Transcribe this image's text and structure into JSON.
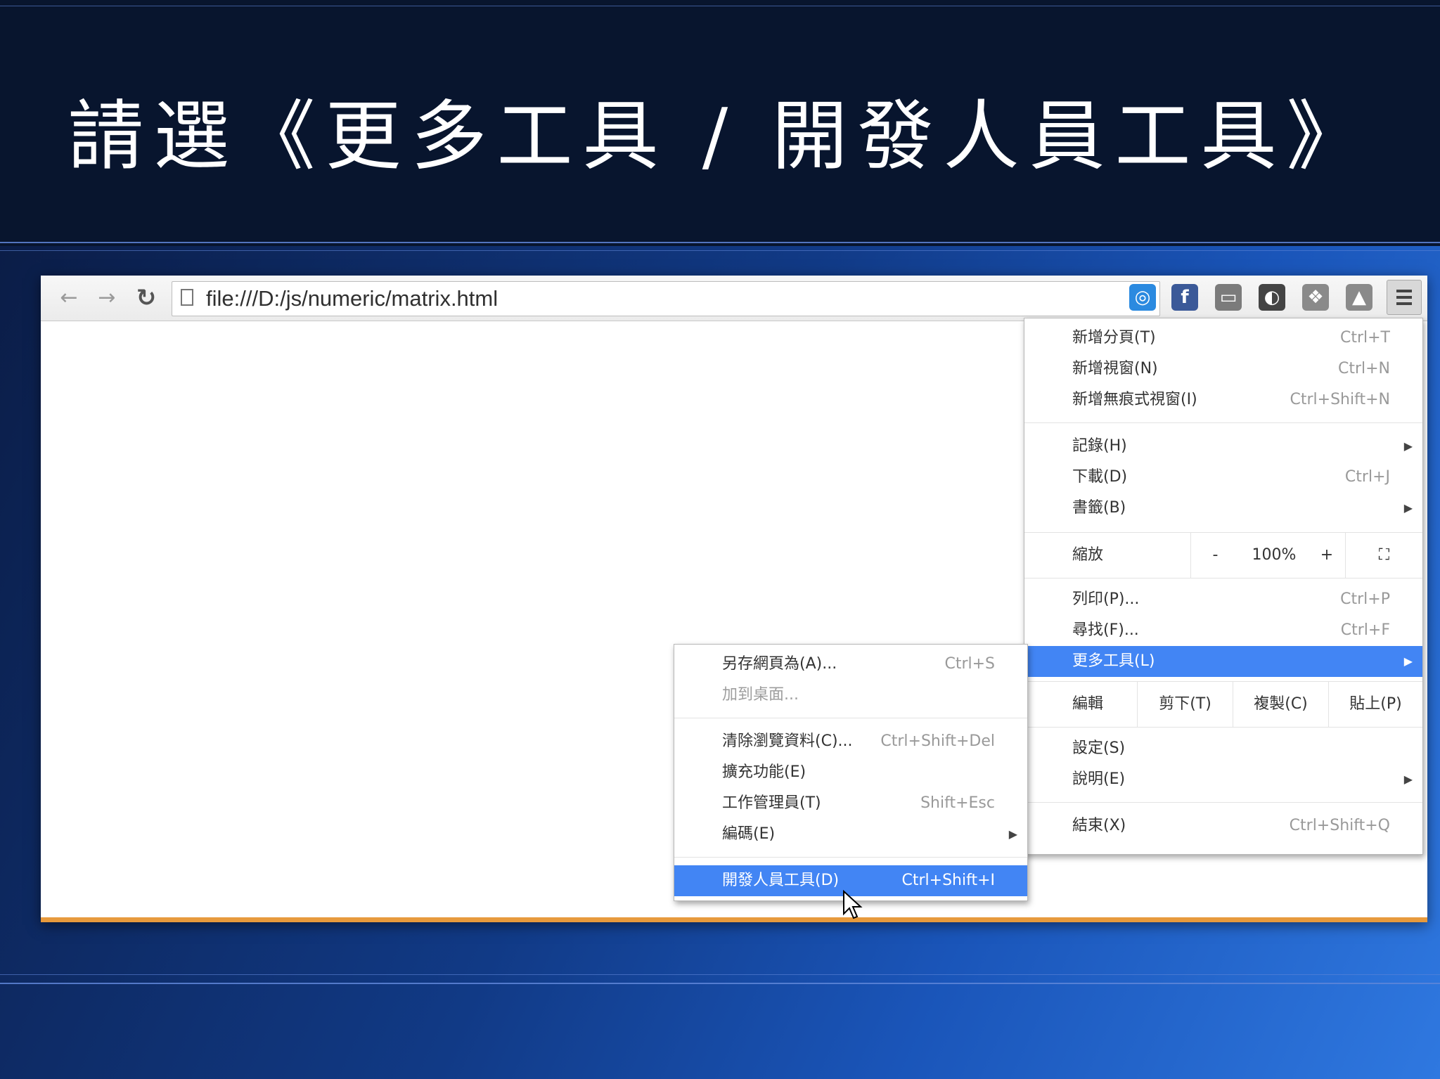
{
  "slide": {
    "title": "請選《更多工具 / 開發人員工具》"
  },
  "browser": {
    "nav": {
      "back_icon": "←",
      "forward_icon": "→",
      "reload_icon": "C"
    },
    "url": "file:///D:/js/numeric/matrix.html",
    "star_icon": "☆",
    "extensions": [
      {
        "name": "blue-circle-ext-icon",
        "glyph": "◎",
        "color": "#2b8ae0"
      },
      {
        "name": "facebook-ext-icon",
        "glyph": "f",
        "color": "#3b5998"
      },
      {
        "name": "keyboard-ext-icon",
        "glyph": "▭",
        "color": "#7b7b7b"
      },
      {
        "name": "dark-disc-ext-icon",
        "glyph": "◐",
        "color": "#444444"
      },
      {
        "name": "dropbox-ext-icon",
        "glyph": "❖",
        "color": "#8a8a8a"
      },
      {
        "name": "drive-ext-icon",
        "glyph": "▲",
        "color": "#8a8a8a"
      }
    ],
    "accent_bottom": "#e79a3d"
  },
  "main_menu": {
    "items_group1": [
      {
        "label": "新增分頁(T)",
        "shortcut": "Ctrl+T"
      },
      {
        "label": "新增視窗(N)",
        "shortcut": "Ctrl+N"
      },
      {
        "label": "新增無痕式視窗(I)",
        "shortcut": "Ctrl+Shift+N"
      }
    ],
    "items_group2": [
      {
        "label": "記錄(H)",
        "shortcut": "",
        "arrow": "▶"
      },
      {
        "label": "下載(D)",
        "shortcut": "Ctrl+J"
      },
      {
        "label": "書籤(B)",
        "shortcut": "",
        "arrow": "▶"
      }
    ],
    "zoom": {
      "label": "縮放",
      "minus": "-",
      "value": "100%",
      "plus": "+",
      "fullscreen": "⛶"
    },
    "items_group3": [
      {
        "label": "列印(P)...",
        "shortcut": "Ctrl+P"
      },
      {
        "label": "尋找(F)...",
        "shortcut": "Ctrl+F"
      },
      {
        "label": "更多工具(L)",
        "shortcut": "",
        "arrow": "▶"
      }
    ],
    "edit": {
      "label": "編輯",
      "cut": "剪下(T)",
      "copy": "複製(C)",
      "paste": "貼上(P)"
    },
    "items_group4": [
      {
        "label": "設定(S)",
        "shortcut": ""
      },
      {
        "label": "說明(E)",
        "shortcut": "",
        "arrow": "▶"
      }
    ],
    "exit": {
      "label": "結束(X)",
      "shortcut": "Ctrl+Shift+Q"
    }
  },
  "sub_menu": {
    "items_group1": [
      {
        "label": "另存網頁為(A)...",
        "shortcut": "Ctrl+S"
      },
      {
        "label": "加到桌面...",
        "shortcut": ""
      }
    ],
    "items_group2": [
      {
        "label": "清除瀏覽資料(C)...",
        "shortcut": "Ctrl+Shift+Del"
      },
      {
        "label": "擴充功能(E)",
        "shortcut": ""
      },
      {
        "label": "工作管理員(T)",
        "shortcut": "Shift+Esc"
      },
      {
        "label": "編碼(E)",
        "shortcut": "",
        "arrow": "▶"
      }
    ],
    "devtools": {
      "label": "開發人員工具(D)",
      "shortcut": "Ctrl+Shift+I"
    }
  }
}
